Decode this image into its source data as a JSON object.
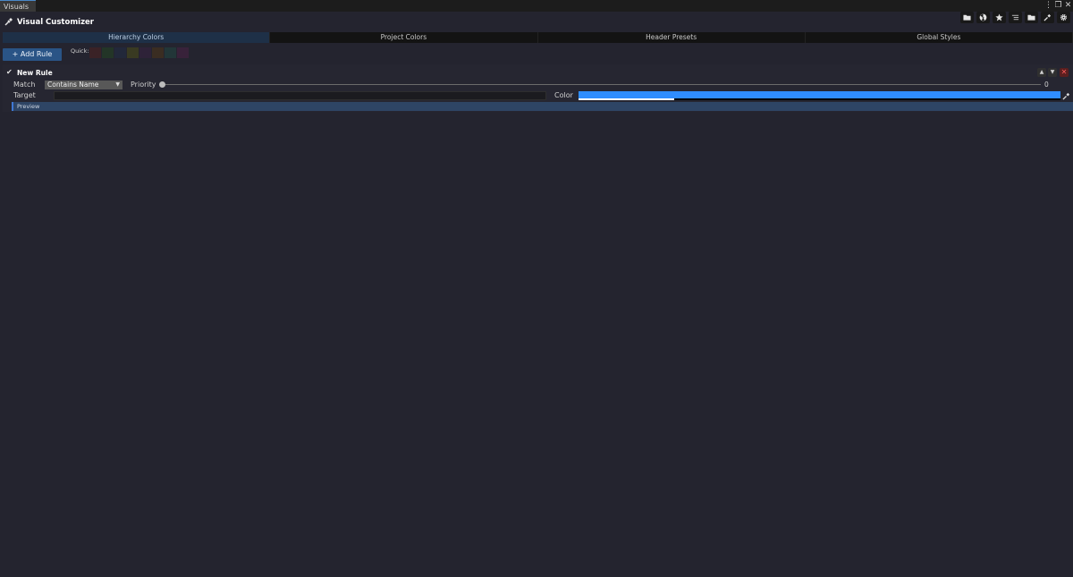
{
  "window": {
    "tab_label": "Visuals",
    "menu_icon": "⋮",
    "maximize_icon": "❐",
    "close_icon": "✕"
  },
  "header": {
    "title": "Visual Customizer"
  },
  "toolbar": {
    "buttons": [
      {
        "name": "folder-icon"
      },
      {
        "name": "radiation-icon"
      },
      {
        "name": "star-icon"
      },
      {
        "name": "list-icon"
      },
      {
        "name": "folder-icon"
      },
      {
        "name": "eyedropper-icon"
      },
      {
        "name": "gear-icon"
      }
    ]
  },
  "tabs": [
    {
      "label": "Hierarchy Colors",
      "active": true
    },
    {
      "label": "Project Colors",
      "active": false
    },
    {
      "label": "Header Presets",
      "active": false
    },
    {
      "label": "Global Styles",
      "active": false
    }
  ],
  "actions": {
    "add_rule_label": "+ Add Rule",
    "quick_label": "Quick:"
  },
  "quick_colors": [
    "#3a2226",
    "#233527",
    "#22283a",
    "#393a22",
    "#2e2238",
    "#3a2d22",
    "#223638",
    "#38223a"
  ],
  "rule": {
    "enabled_icon": "✔",
    "name": "New Rule",
    "match_label": "Match",
    "match_value": "Contains Name",
    "priority_label": "Priority",
    "priority_value": "0",
    "target_label": "Target",
    "target_value": "",
    "color_label": "Color",
    "color_value": "#2f8dff",
    "preview_label": "Preview",
    "move_up_icon": "▲",
    "move_down_icon": "▼",
    "delete_icon": "✕"
  }
}
